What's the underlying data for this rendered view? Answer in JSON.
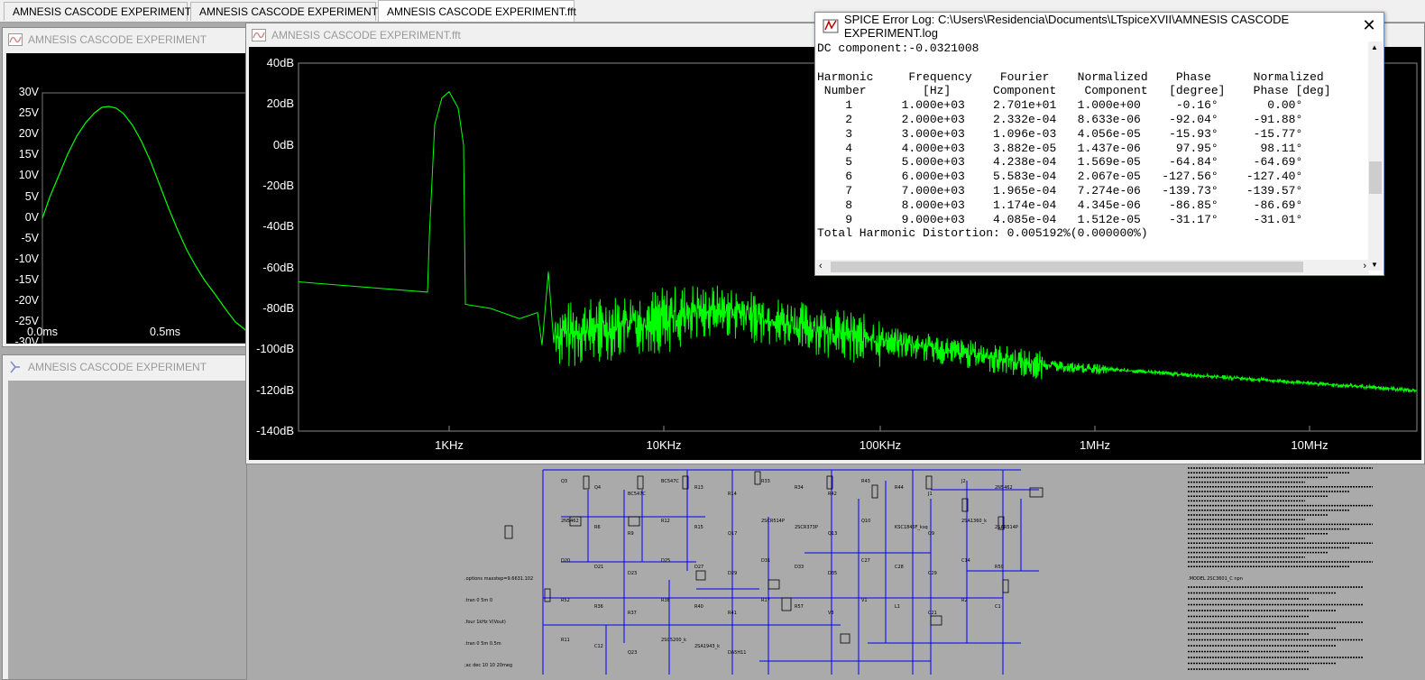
{
  "tabs": [
    {
      "label": "AMNESIS CASCODE EXPERIMENT",
      "icon": "waveform-icon"
    },
    {
      "label": "AMNESIS CASCODE EXPERIMENT",
      "icon": "schematic-icon"
    },
    {
      "label": "AMNESIS CASCODE EXPERIMENT.fft",
      "icon": "waveform-icon"
    }
  ],
  "waveform_window": {
    "title": "AMNESIS CASCODE EXPERIMENT",
    "y_ticks": [
      "30V",
      "25V",
      "20V",
      "15V",
      "10V",
      "5V",
      "0V",
      "-5V",
      "-10V",
      "-15V",
      "-20V",
      "-25V",
      "-30V"
    ],
    "x_ticks": [
      "0.0ms",
      "0.5ms"
    ]
  },
  "schematic_window": {
    "title": "AMNESIS CASCODE EXPERIMENT"
  },
  "fft_window": {
    "title": "AMNESIS CASCODE EXPERIMENT.fft",
    "y_ticks": [
      "40dB",
      "20dB",
      "0dB",
      "-20dB",
      "-40dB",
      "-60dB",
      "-80dB",
      "-100dB",
      "-120dB",
      "-140dB"
    ],
    "x_ticks": [
      "1KHz",
      "10KHz",
      "100KHz",
      "1MHz",
      "10MHz"
    ]
  },
  "error_log": {
    "title": "SPICE Error Log: C:\\Users\\Residencia\\Documents\\LTspiceXVII\\AMNESIS CASCODE EXPERIMENT.log",
    "lines": [
      "DC component:-0.0321008",
      "",
      "Harmonic     Frequency    Fourier    Normalized    Phase      Normalized",
      " Number        [Hz]      Component    Component   [degree]    Phase [deg]",
      "    1       1.000e+03    2.701e+01   1.000e+00     -0.16°       0.00°",
      "    2       2.000e+03    2.332e-04   8.633e-06    -92.04°     -91.88°",
      "    3       3.000e+03    1.096e-03   4.056e-05    -15.93°     -15.77°",
      "    4       4.000e+03    3.882e-05   1.437e-06     97.95°      98.11°",
      "    5       5.000e+03    4.238e-04   1.569e-05    -64.84°     -64.69°",
      "    6       6.000e+03    5.583e-04   2.067e-05   -127.56°    -127.40°",
      "    7       7.000e+03    1.965e-04   7.274e-06   -139.73°    -139.57°",
      "    8       8.000e+03    1.174e-04   4.345e-06    -86.85°     -86.69°",
      "    9       9.000e+03    4.085e-04   1.512e-05    -31.17°     -31.01°",
      "Total Harmonic Distortion: 0.005192%(0.000000%)"
    ]
  },
  "schematic_labels": [
    "Q3",
    "Q4",
    "BC547C",
    "BC547C",
    "R13",
    "R14",
    "R33",
    "R34",
    "R42",
    "R43",
    "R44",
    "J1",
    "J2",
    "2N5462",
    "2N5462",
    "R6",
    "R9",
    "R12",
    "R15",
    "Q17",
    "2SCR514P",
    "2SCR373P",
    "Q13",
    "Q10",
    "KSC1845F_ksq",
    "Q9",
    "2SA1360_k",
    "2SAR514P",
    "D20",
    "D21",
    "D23",
    "D25",
    "D27",
    "D29",
    "D31",
    "D33",
    "D35",
    "C27",
    "C28",
    "C29",
    "C14",
    "R50",
    "R52",
    "R36",
    "R37",
    "R38",
    "R40",
    "R41",
    "R17",
    "R57",
    "V3",
    "V1",
    "L1",
    "C21",
    "R2",
    "C1",
    "R11",
    "C12",
    "Q23",
    "2SC5200_k",
    "2SA1943_k",
    "DA5H11",
    ".options maxstep=9.6631.102",
    ".tran 0 5m 0",
    ".four 1kHz V(Vout)",
    ".tran 0 5m 0.5m",
    ";ac dec 10 10 20meg",
    ".MODEL 2SC3601_C npn"
  ],
  "colors": {
    "trace": "#00ff00",
    "plot_bg": "#000000",
    "wire": "#0000ff",
    "grid": "#555555"
  }
}
